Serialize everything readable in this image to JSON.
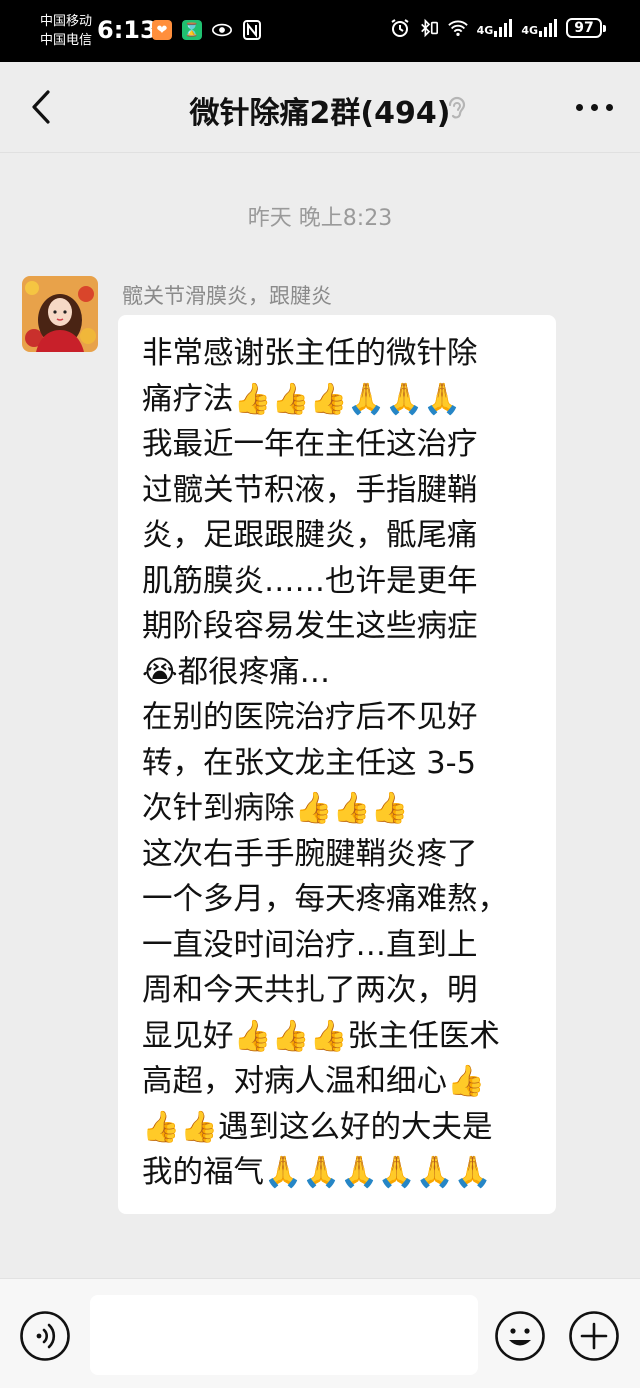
{
  "status_bar": {
    "carrier1": "中国移动",
    "carrier2": "中国电信",
    "time": "6:13",
    "network1": "4G",
    "network2": "4G",
    "battery": "97"
  },
  "header": {
    "title": "微针除痛2群(494)"
  },
  "chat": {
    "timestamp": "昨天 晚上8:23",
    "message": {
      "sender": "髋关节滑膜炎，跟腱炎",
      "lines": [
        "非常感谢张主任的微针除",
        "痛疗法👍👍👍🙏🙏🙏",
        "我最近一年在主任这治疗",
        "过髋关节积液，手指腱鞘",
        "炎，足跟跟腱炎，骶尾痛",
        "肌筋膜炎……也许是更年",
        "期阶段容易发生这些病症",
        "😭都很疼痛…",
        "在别的医院治疗后不见好",
        "转，在张文龙主任这 3-5",
        "次针到病除👍👍👍",
        "这次右手手腕腱鞘炎疼了",
        "一个多月，每天疼痛难熬，",
        "一直没时间治疗…直到上",
        "周和今天共扎了两次，明",
        "显见好👍👍👍张主任医术",
        "高超，对病人温和细心👍",
        "👍👍遇到这么好的大夫是",
        "我的福气🙏🙏🙏🙏🙏🙏"
      ]
    }
  },
  "input_bar": {
    "placeholder": ""
  },
  "icons": {
    "back": "back-arrow-icon",
    "mute": "mute-ear-icon",
    "more": "more-dots-icon",
    "voice": "voice-icon",
    "emoji": "emoji-icon",
    "plus": "plus-icon"
  }
}
